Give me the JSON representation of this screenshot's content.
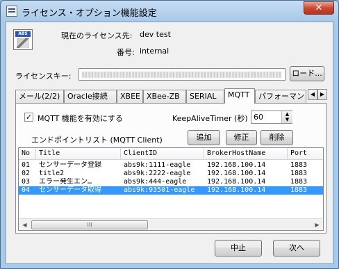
{
  "window": {
    "title": "ライセンス・オプション機能設定",
    "close_glyph": "✕"
  },
  "logo": {
    "text": "ABS"
  },
  "license_info": {
    "holder_label": "現在のライセンス先:",
    "holder_value": "dev test",
    "number_label": "番号:",
    "number_value": "internal",
    "key_label": "ライセンスキー:",
    "load_button": "ロード..."
  },
  "tabs": {
    "items": [
      {
        "label": "メール(2/2)"
      },
      {
        "label": "Oracle接続"
      },
      {
        "label": "XBEE"
      },
      {
        "label": "XBee-ZB"
      },
      {
        "label": "SERIAL"
      },
      {
        "label": "MQTT"
      },
      {
        "label": "パフォーマン"
      }
    ],
    "active_index": 5,
    "scroll_left": "◀",
    "scroll_right": "▶"
  },
  "mqtt": {
    "enable_label": "MQTT 機能を有効にする",
    "enable_checked": true,
    "check_glyph": "✓",
    "keepalive_label": "KeepAliveTimer (秒)",
    "keepalive_value": "60",
    "spin_up": "▲",
    "spin_down": "▼",
    "endpoint_list_label": "エンドポイントリスト (MQTT Client)",
    "add_button": "追加",
    "edit_button": "修正",
    "delete_button": "削除"
  },
  "endpoints": {
    "columns": [
      "No",
      "Title",
      "ClientID",
      "BrokerHostName",
      "Port"
    ],
    "rows": [
      {
        "no": "01",
        "title": "センサーデータ登録",
        "client_id": "abs9k:1111-eagle",
        "broker": "192.168.100.14",
        "port": "1883",
        "selected": false
      },
      {
        "no": "02",
        "title": "title2",
        "client_id": "abs9k:2222-eagle",
        "broker": "192.168.100.14",
        "port": "1883",
        "selected": false
      },
      {
        "no": "03",
        "title": "エラー発生エン…",
        "client_id": "abs9k:444-eagle",
        "broker": "192.168.100.14",
        "port": "1883",
        "selected": false
      },
      {
        "no": "04",
        "title": "センサーデータ取得",
        "client_id": "abs9k:93501-eagle",
        "broker": "192.168.100.14",
        "port": "1883",
        "selected": true
      }
    ],
    "scroll_left": "◀",
    "scroll_right": "▶",
    "thumb_grip": "III"
  },
  "footer": {
    "cancel_button": "中止",
    "next_button": "次へ"
  }
}
